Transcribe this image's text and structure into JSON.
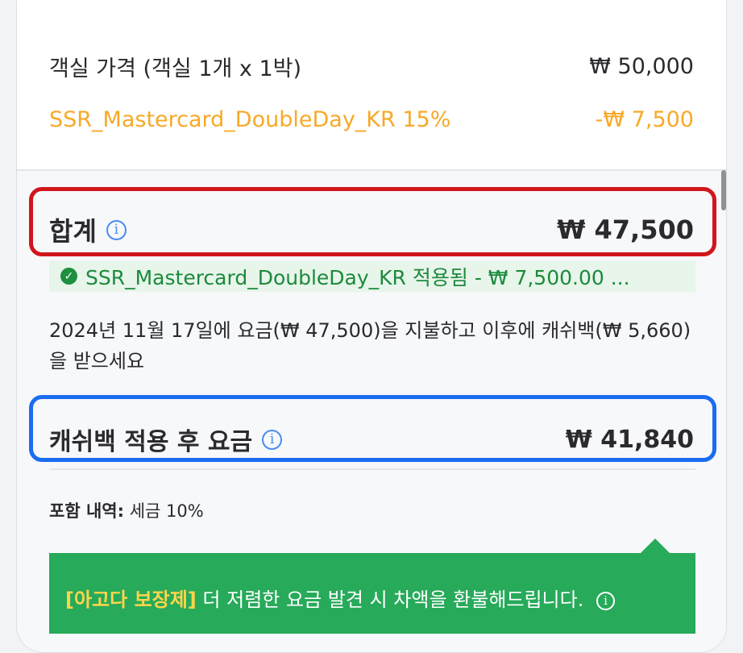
{
  "room_price": {
    "label": "객실 가격 (객실 1개 x 1박)",
    "value": "₩ 50,000"
  },
  "promo": {
    "label": "SSR_Mastercard_DoubleDay_KR 15%",
    "value": "-₩ 7,500",
    "color": "#f7a928"
  },
  "total": {
    "label": "합계",
    "value": "₩ 47,500",
    "info_icon": "info-icon"
  },
  "applied_banner": {
    "text": "SSR_Mastercard_DoubleDay_KR 적용됨 - ₩ 7,500.00 ...",
    "icon": "check-circle-icon"
  },
  "pay_note": "2024년 11월 17일에 요금(₩ 47,500)을 지불하고 이후에 캐쉬백(₩ 5,660)을 받으세요",
  "cashback": {
    "label": "캐쉬백 적용 후 요금",
    "value": "₩ 41,840",
    "info_icon": "info-icon"
  },
  "includes": {
    "label": "포함 내역:",
    "value": "세금 10%"
  },
  "guarantee": {
    "title": "[아고다 보장제]",
    "text": "더 저렴한 요금 발견 시 차액을 환불해드립니다.",
    "info_icon": "info-icon",
    "color": "#27aa5a"
  },
  "highlights": {
    "red": "#d0161c",
    "blue": "#1a6cf0"
  }
}
